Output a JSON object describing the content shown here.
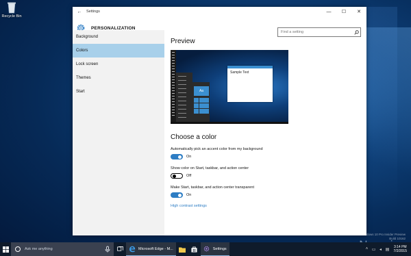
{
  "desktop": {
    "recycle_bin_label": "Recycle Bin"
  },
  "window": {
    "title": "Settings",
    "section_title": "PERSONALIZATION",
    "search_placeholder": "Find a setting",
    "controls": {
      "minimize": "—",
      "maximize": "☐",
      "close": "✕"
    }
  },
  "sidebar": {
    "items": [
      {
        "label": "Background",
        "active": false
      },
      {
        "label": "Colors",
        "active": true
      },
      {
        "label": "Lock screen",
        "active": false
      },
      {
        "label": "Themes",
        "active": false
      },
      {
        "label": "Start",
        "active": false
      }
    ]
  },
  "main": {
    "preview_heading": "Preview",
    "preview_sample_text": "Sample Text",
    "preview_tile_text": "Aa",
    "color_heading": "Choose a color",
    "options": [
      {
        "label": "Automatically pick an accent color from my background",
        "state": "On",
        "on": true
      },
      {
        "label": "Show color on Start, taskbar, and action center",
        "state": "Off",
        "on": false
      },
      {
        "label": "Make Start, taskbar, and action center transparent",
        "state": "On",
        "on": true
      }
    ],
    "high_contrast_link": "High contrast settings",
    "accent_color": "#2d7dc4"
  },
  "taskbar": {
    "search_placeholder": "Ask me anything",
    "apps": [
      {
        "label": "Microsoft Edge - M...",
        "icon": "edge-icon"
      },
      {
        "label": "Settings",
        "icon": "gear-icon"
      }
    ],
    "time": "3:14 PM",
    "date": "7/2/2015"
  },
  "watermark": {
    "line1": "Windows 10 Pro Insider Preview",
    "line2": "Build 10162",
    "brand": "Neowin"
  }
}
